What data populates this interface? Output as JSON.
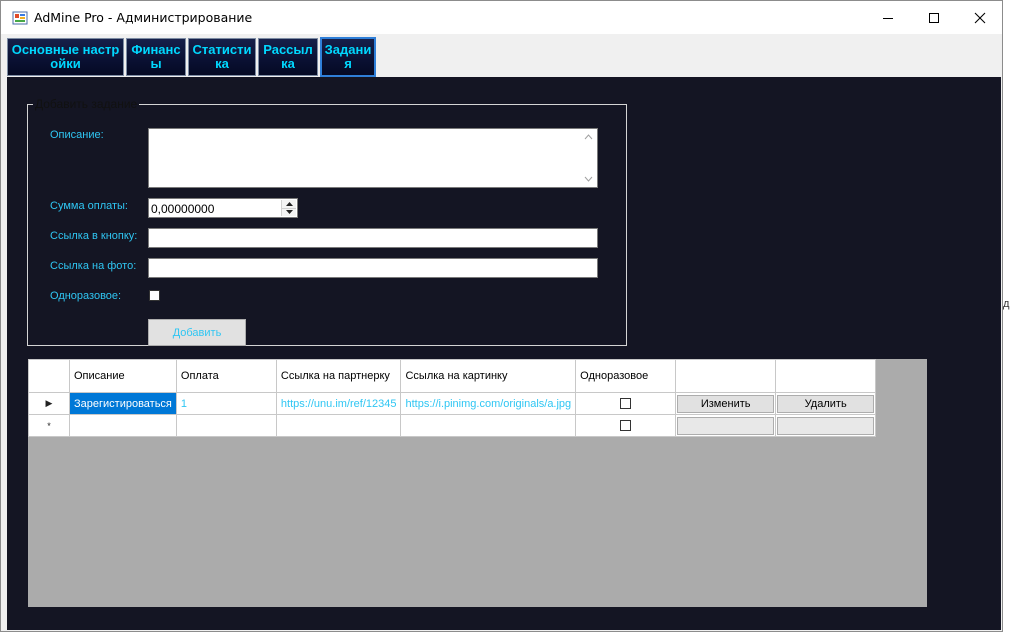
{
  "window": {
    "title": "AdMine Pro - Администрирование",
    "controls": [
      "minimize",
      "maximize",
      "close"
    ]
  },
  "tabs": [
    {
      "label": "Основные настройки",
      "active": false
    },
    {
      "label": "Финансы",
      "active": false
    },
    {
      "label": "Статистика",
      "active": false
    },
    {
      "label": "Рассылка",
      "active": false
    },
    {
      "label": "Задания",
      "active": true
    }
  ],
  "form": {
    "group_title": "Добавить задание",
    "description_label": "Описание:",
    "description_value": "",
    "amount_label": "Сумма оплаты:",
    "amount_value": "0,00000000",
    "button_link_label": "Ссылка в кнопку:",
    "button_link_value": "",
    "photo_link_label": "Ссылка на фото:",
    "photo_link_value": "",
    "one_time_label": "Одноразовое:",
    "one_time_checked": false,
    "add_button": "Добавить"
  },
  "grid": {
    "columns": [
      "Описание",
      "Оплата",
      "Ссылка на партнерку",
      "Ссылка на картинку",
      "Одноразовое",
      "",
      ""
    ],
    "rows": [
      {
        "marker": "▶",
        "description": "Зарегистироваться",
        "payment": "1",
        "partner_link": "https://unu.im/ref/12345",
        "image_link": "https://i.pinimg.com/originals/a.jpg",
        "one_time": false,
        "edit_label": "Изменить",
        "delete_label": "Удалить"
      },
      {
        "marker": "*",
        "description": "",
        "payment": "",
        "partner_link": "",
        "image_link": "",
        "one_time": false,
        "edit_label": "",
        "delete_label": ""
      }
    ]
  },
  "colors": {
    "panel_background": "#141523",
    "label_text": "#2fc6f3",
    "tab_text": "#00d8ff",
    "grid_background": "#ababab",
    "selection": "#0078d7"
  }
}
